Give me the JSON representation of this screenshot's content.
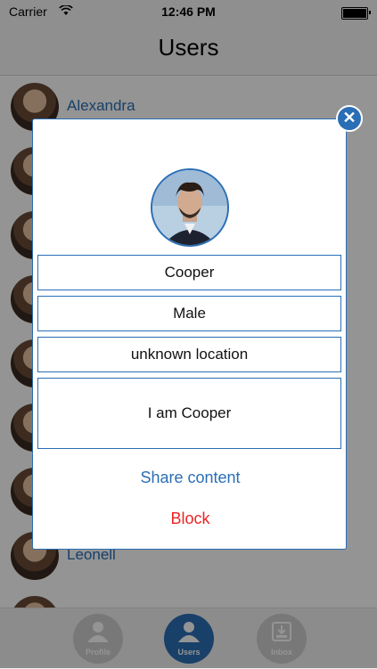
{
  "status_bar": {
    "carrier": "Carrier",
    "time": "12:46 PM"
  },
  "nav": {
    "title": "Users"
  },
  "list": {
    "items": [
      {
        "name": "Alexandra"
      },
      {
        "name": ""
      },
      {
        "name": ""
      },
      {
        "name": ""
      },
      {
        "name": ""
      },
      {
        "name": ""
      },
      {
        "name": ""
      },
      {
        "name": "Leonell"
      },
      {
        "name": ""
      }
    ]
  },
  "tabs": [
    {
      "label": "Profile",
      "icon": "person-icon",
      "active": false
    },
    {
      "label": "Users",
      "icon": "users-icon",
      "active": true
    },
    {
      "label": "Inbox",
      "icon": "inbox-icon",
      "active": false
    }
  ],
  "modal": {
    "name": "Cooper",
    "gender": "Male",
    "location": "unknown location",
    "bio": "I am Cooper",
    "share_label": "Share content",
    "block_label": "Block",
    "close_icon": "close-icon"
  },
  "colors": {
    "accent": "#2a6eb5",
    "danger": "#ee2222",
    "overlay": "rgba(0,0,0,0.42)"
  }
}
